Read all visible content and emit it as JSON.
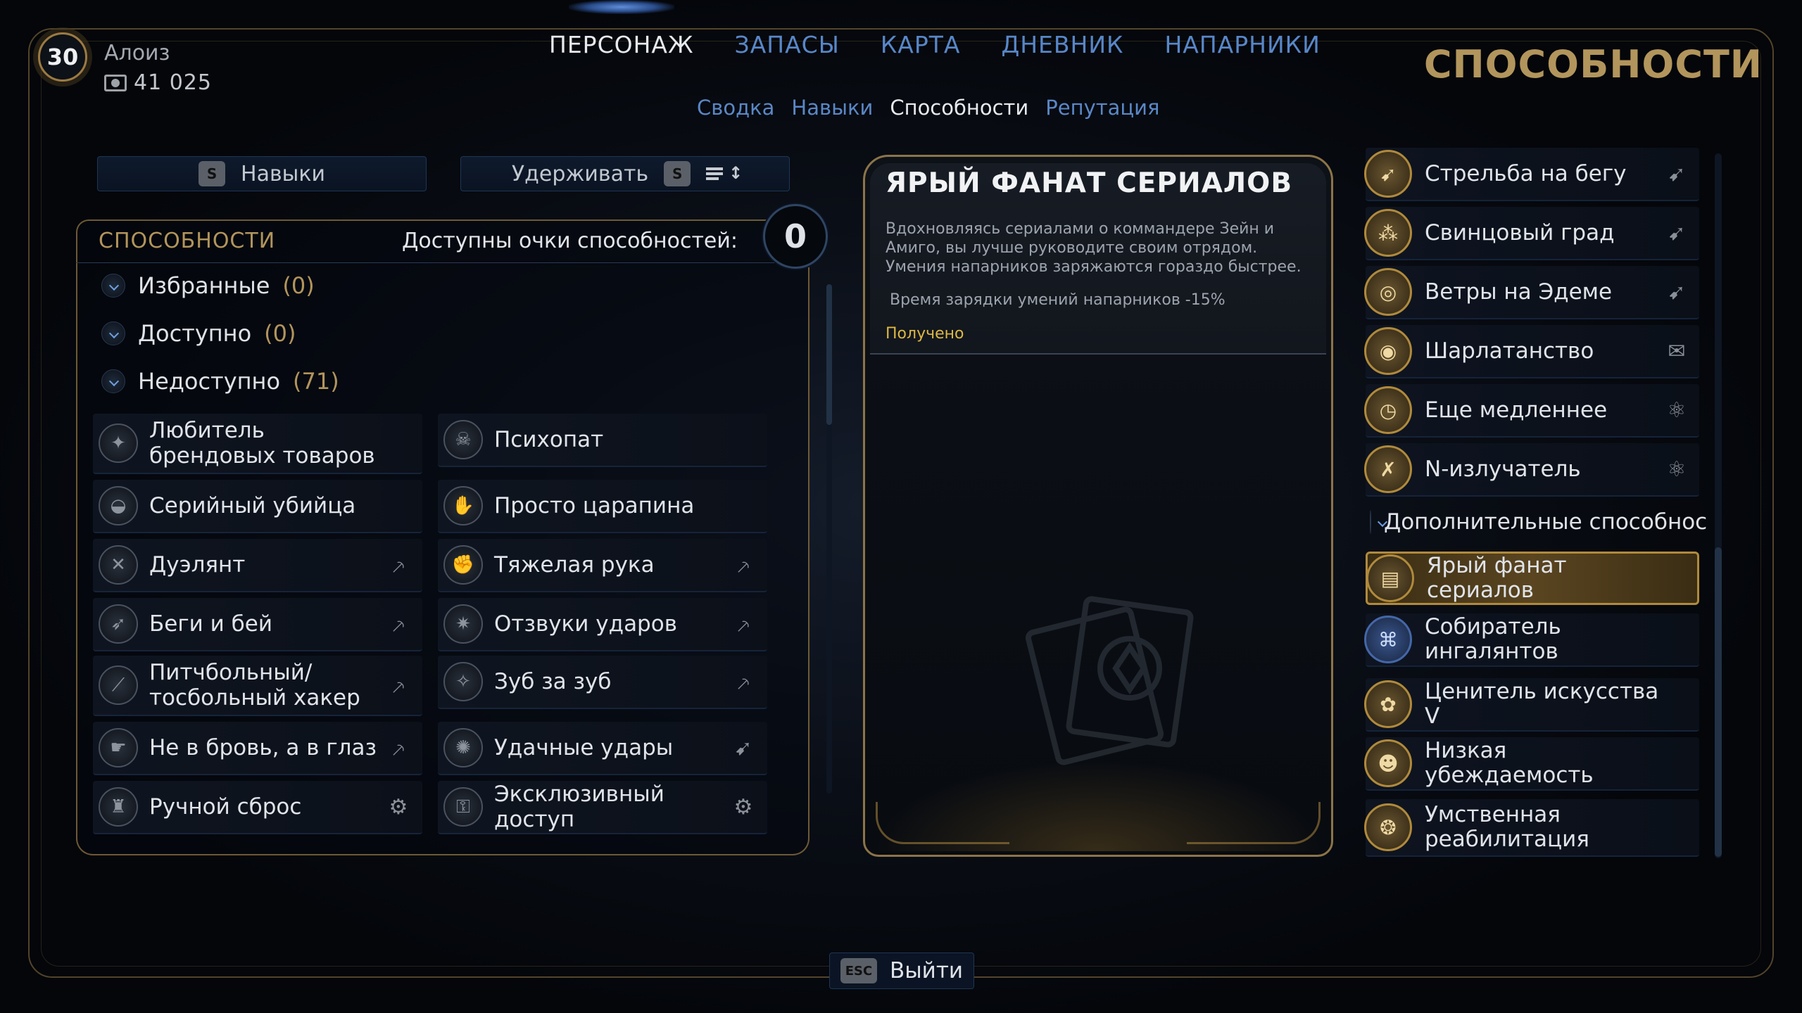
{
  "player": {
    "level": "30",
    "name": "Алоиз",
    "money": "41 025"
  },
  "nav": {
    "tabs": [
      {
        "label": "ПЕРСОНАЖ",
        "active": true
      },
      {
        "label": "ЗАПАСЫ",
        "active": false
      },
      {
        "label": "КАРТА",
        "active": false
      },
      {
        "label": "ДНЕВНИК",
        "active": false
      },
      {
        "label": "НАПАРНИКИ",
        "active": false
      }
    ],
    "subtabs": [
      {
        "label": "Сводка",
        "active": false
      },
      {
        "label": "Навыки",
        "active": false
      },
      {
        "label": "Способности",
        "active": true
      },
      {
        "label": "Репутация",
        "active": false
      }
    ]
  },
  "page_title": "СПОСОБНОСТИ",
  "controls": {
    "skills_key": "S",
    "skills_label": "Навыки",
    "hold_label": "Удерживать",
    "hold_key": "S",
    "sort_icon": "sort-icon"
  },
  "abilities_panel": {
    "title": "СПОСОБНОСТИ",
    "points_label": "Доступны очки способностей:",
    "points": "0",
    "categories": [
      {
        "label": "Избранные",
        "count": "(0)"
      },
      {
        "label": "Доступно",
        "count": "(0)"
      },
      {
        "label": "Недоступно",
        "count": "(71)"
      }
    ],
    "cards": [
      {
        "label": "Любитель брендовых товаров",
        "icon": "shopping-icon",
        "tag": ""
      },
      {
        "label": "Психопат",
        "icon": "demon-face-icon",
        "tag": ""
      },
      {
        "label": "Серийный убийца",
        "icon": "bowl-icon",
        "tag": ""
      },
      {
        "label": "Просто царапина",
        "icon": "claw-icon",
        "tag": ""
      },
      {
        "label": "Дуэлянт",
        "icon": "crossed-swords-icon",
        "tag": "melee-weapon-icon"
      },
      {
        "label": "Тяжелая рука",
        "icon": "fist-icon",
        "tag": "melee-weapon-icon"
      },
      {
        "label": "Беги и бей",
        "icon": "running-icon",
        "tag": "melee-weapon-icon"
      },
      {
        "label": "Отзвуки ударов",
        "icon": "burst-icon",
        "tag": "melee-weapon-icon"
      },
      {
        "label": "Питчбольный/ тосбольный хакер",
        "icon": "bat-icon",
        "tag": "melee-weapon-icon"
      },
      {
        "label": "Зуб за зуб",
        "icon": "tooth-icon",
        "tag": "melee-weapon-icon"
      },
      {
        "label": "Не в бровь, а в глаз",
        "icon": "hand-strike-icon",
        "tag": "melee-weapon-icon"
      },
      {
        "label": "Удачные удары",
        "icon": "star-burst-icon",
        "tag": "ranged-weapon-icon"
      },
      {
        "label": "Ручной сброс",
        "icon": "robot-icon",
        "tag": "gadget-icon"
      },
      {
        "label": "Эксклюзивный доступ",
        "icon": "lock-icon",
        "tag": "gadget-icon"
      }
    ]
  },
  "detail": {
    "title": "ЯРЫЙ ФАНАТ СЕРИАЛОВ",
    "description": "Вдохновляясь сериалами о коммандере Зейн и Амиго, вы лучше руководите своим отрядом. Умения напарников заряжаются гораздо быстрее.",
    "stat": "Время зарядки умений напарников -15%",
    "status": "Получено",
    "icon": "cards-book-icon"
  },
  "owned": {
    "items": [
      {
        "label": "Стрельба на бегу",
        "icon": "running-gun-icon",
        "tag": "ranged-weapon-icon"
      },
      {
        "label": "Свинцовый град",
        "icon": "bullets-icon",
        "tag": "ranged-weapon-icon"
      },
      {
        "label": "Ветры на Эдеме",
        "icon": "target-icon",
        "tag": "ranged-weapon-icon"
      }
    ],
    "items2": [
      {
        "label": "Шарлатанство",
        "icon": "eye-icon",
        "tag": "dialogue-icon"
      },
      {
        "label": "Еще медленнее",
        "icon": "clock-icon",
        "tag": "science-icon"
      },
      {
        "label": "N-излучатель",
        "icon": "crossed-icon",
        "tag": "science-icon"
      }
    ],
    "sub_header": "Дополнительные способности",
    "extra": [
      {
        "label": "Ярый фанат сериалов",
        "icon": "cards-book-icon",
        "selected": true,
        "blue": false
      },
      {
        "label": "Собиратель ингалянтов",
        "icon": "inhaler-icon",
        "selected": false,
        "blue": true
      },
      {
        "label": "Ценитель искусства V",
        "icon": "palette-icon",
        "selected": false,
        "blue": false
      },
      {
        "label": "Низкая убеждаемость",
        "icon": "head-icon",
        "selected": false,
        "blue": false
      },
      {
        "label": "Умственная реабилитация",
        "icon": "brain-icon",
        "selected": false,
        "blue": false
      }
    ]
  },
  "exit": {
    "key": "ESC",
    "label": "Выйти"
  },
  "colors": {
    "accent_gold": "#b2955c",
    "tab_blue": "#5887c8",
    "points_gold": "#dcb843"
  }
}
